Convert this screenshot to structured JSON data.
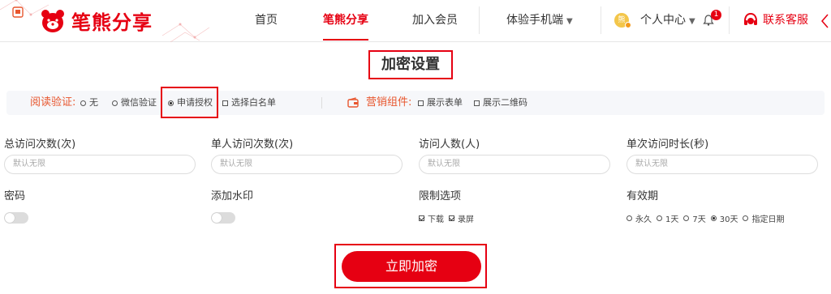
{
  "header": {
    "logo_text": "笔熊分享",
    "nav": [
      "首页",
      "笔熊分享",
      "加入会员",
      "体验手机端"
    ],
    "user_center": "个人中心",
    "notification_count": "1",
    "customer_service": "联系客服",
    "avatar_text": "熊"
  },
  "title": "加密设置",
  "read_verify": {
    "label": "阅读验证:",
    "options": [
      "无",
      "微信验证",
      "申请授权",
      "选择白名单"
    ],
    "selected": "申请授权"
  },
  "marketing": {
    "label": "营销组件:",
    "options": [
      "展示表单",
      "展示二维码"
    ]
  },
  "fields": [
    {
      "label": "总访问次数(次)",
      "placeholder": "默认无限"
    },
    {
      "label": "单人访问次数(次)",
      "placeholder": "默认无限"
    },
    {
      "label": "访问人数(人)",
      "placeholder": "默认无限"
    },
    {
      "label": "单次访问时长(秒)",
      "placeholder": "默认无限"
    }
  ],
  "password": {
    "label": "密码"
  },
  "watermark": {
    "label": "添加水印"
  },
  "restrictions": {
    "label": "限制选项",
    "options": [
      "下载",
      "录屏"
    ],
    "checked": [
      "下载",
      "录屏"
    ]
  },
  "validity": {
    "label": "有效期",
    "options": [
      "永久",
      "1天",
      "7天",
      "30天",
      "指定日期"
    ],
    "selected": "30天"
  },
  "submit_label": "立即加密",
  "colors": {
    "brand": "#e60012",
    "accent_orange": "#e8572f"
  }
}
